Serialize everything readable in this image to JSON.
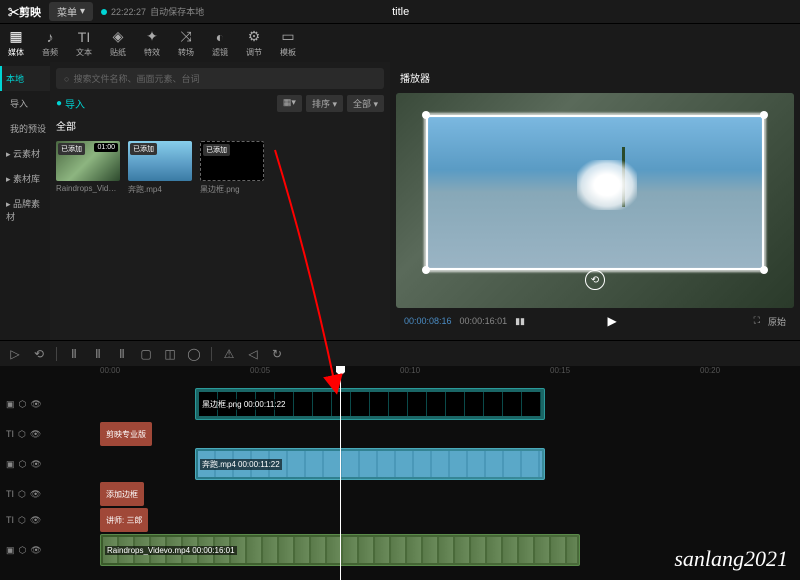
{
  "app": {
    "name": "✂剪映",
    "menu": "菜单",
    "autosave_time": "22:22:27",
    "autosave_text": "自动保存本地",
    "title": "title"
  },
  "tools": [
    {
      "icon": "▦",
      "label": "媒体"
    },
    {
      "icon": "♪",
      "label": "音频"
    },
    {
      "icon": "TI",
      "label": "文本"
    },
    {
      "icon": "◈",
      "label": "贴纸"
    },
    {
      "icon": "✦",
      "label": "特效"
    },
    {
      "icon": "⤨",
      "label": "转场"
    },
    {
      "icon": "◐",
      "label": "滤镜"
    },
    {
      "icon": "⚙",
      "label": "调节"
    },
    {
      "icon": "▭",
      "label": "模板"
    }
  ],
  "sidebar": [
    {
      "label": "本地",
      "active": true
    },
    {
      "label": "导入",
      "sub": true
    },
    {
      "label": "我的预设",
      "sub": true
    },
    {
      "label": "▸ 云素材"
    },
    {
      "label": "▸ 素材库"
    },
    {
      "label": "▸ 品牌素材"
    }
  ],
  "search": {
    "placeholder": "搜索文件名称、画面元素、台词"
  },
  "import": {
    "label": "导入"
  },
  "sort": {
    "view": "▦▾",
    "sort": "排序 ▾",
    "filter": "全部 ▾"
  },
  "tab_all": "全部",
  "thumbs": [
    {
      "badge": "已添加",
      "dur": "01:00",
      "name": "Raindrops_Videvo.mp4"
    },
    {
      "badge": "已添加",
      "name": "奔跑.mp4"
    },
    {
      "badge": "已添加",
      "name": "黑边框.png"
    }
  ],
  "player": {
    "title": "播放器",
    "time_cur": "00:00:08:16",
    "time_dur": "00:00:16:01",
    "expand": "⛶",
    "ratio": "原始"
  },
  "ruler": [
    "00:00",
    "00:05",
    "00:10",
    "00:15",
    "00:20"
  ],
  "clips": {
    "border": {
      "name": "黑边框.png",
      "dur": "00:00:11:22"
    },
    "tag1": "剪映专业版",
    "video": {
      "name": "奔跑.mp4",
      "dur": "00:00:11:22"
    },
    "tag2": "添加边框",
    "tag3": "讲师: 三郎",
    "bg": {
      "name": "Raindrops_Videvo.mp4",
      "dur": "00:00:16:01"
    }
  },
  "watermark": "sanlang2021"
}
